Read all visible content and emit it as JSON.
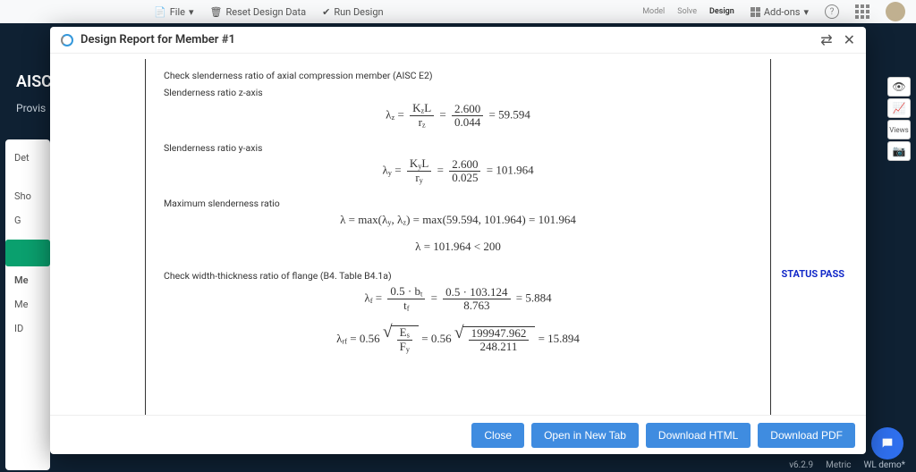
{
  "toolbar": {
    "file_label": "File",
    "reset_label": "Reset Design Data",
    "run_label": "Run Design",
    "addons_label": "Add-ons",
    "tabs": {
      "model": "Model",
      "solve": "Solve",
      "design": "Design"
    }
  },
  "bg": {
    "aisc": "AISC",
    "provisions": "Provis",
    "left": {
      "det": "Det",
      "sho": "Sho",
      "go": "G",
      "me_head": "Me",
      "me": "Me",
      "id": "ID"
    },
    "right": {
      "views": "Views"
    }
  },
  "bottombar": {
    "version": "v6.2.9",
    "metric": "Metric",
    "project": "WL demo*"
  },
  "modal": {
    "title": "Design Report for Member #1",
    "close_icon": "✕",
    "newtab_icon": "⇄"
  },
  "report": {
    "sec1": "Check slenderness ratio of axial compression member (AISC E2)",
    "sec1b": "Slenderness ratio z-axis",
    "eq_z": {
      "lhs": "λ",
      "sub": "z",
      "num1a": "K",
      "num1b": "z",
      "num1c": "L",
      "den1": "r",
      "den1sub": "z",
      "num2": "2.600",
      "den2": "0.044",
      "res": "59.594"
    },
    "sec2": "Slenderness ratio y-axis",
    "eq_y": {
      "lhs": "λ",
      "sub": "y",
      "num1a": "K",
      "num1b": "y",
      "num1c": "L",
      "den1": "r",
      "den1sub": "y",
      "num2": "2.600",
      "den2": "0.025",
      "res": "101.964"
    },
    "sec3": "Maximum slenderness ratio",
    "eq_max": {
      "text_a": "λ = max(λ",
      "sub_a": "y",
      "text_b": ", λ",
      "sub_b": "z",
      "text_c": ") = max(59.594, 101.964) = 101.964"
    },
    "eq_lim": "λ = 101.964 < 200",
    "status": "STATUS PASS",
    "sec4": "Check width-thickness ratio of flange (B4. Table B4.1a)",
    "eq_f": {
      "lhs": "λ",
      "sub": "f",
      "num1": "0.5 · b",
      "num1sub": "t",
      "den1": "t",
      "den1sub": "f",
      "num2": "0.5 · 103.124",
      "den2": "8.763",
      "res": "5.884"
    },
    "eq_rf": {
      "lhs": "λ",
      "sub": "rf",
      "coef": "0.56",
      "rad1n": "E",
      "rad1nsub": "s",
      "rad1d": "F",
      "rad1dsub": "y",
      "rad2n": "199947.962",
      "rad2d": "248.211",
      "res": "15.894"
    }
  },
  "footer": {
    "close": "Close",
    "newtab": "Open in New Tab",
    "html": "Download HTML",
    "pdf": "Download PDF"
  }
}
